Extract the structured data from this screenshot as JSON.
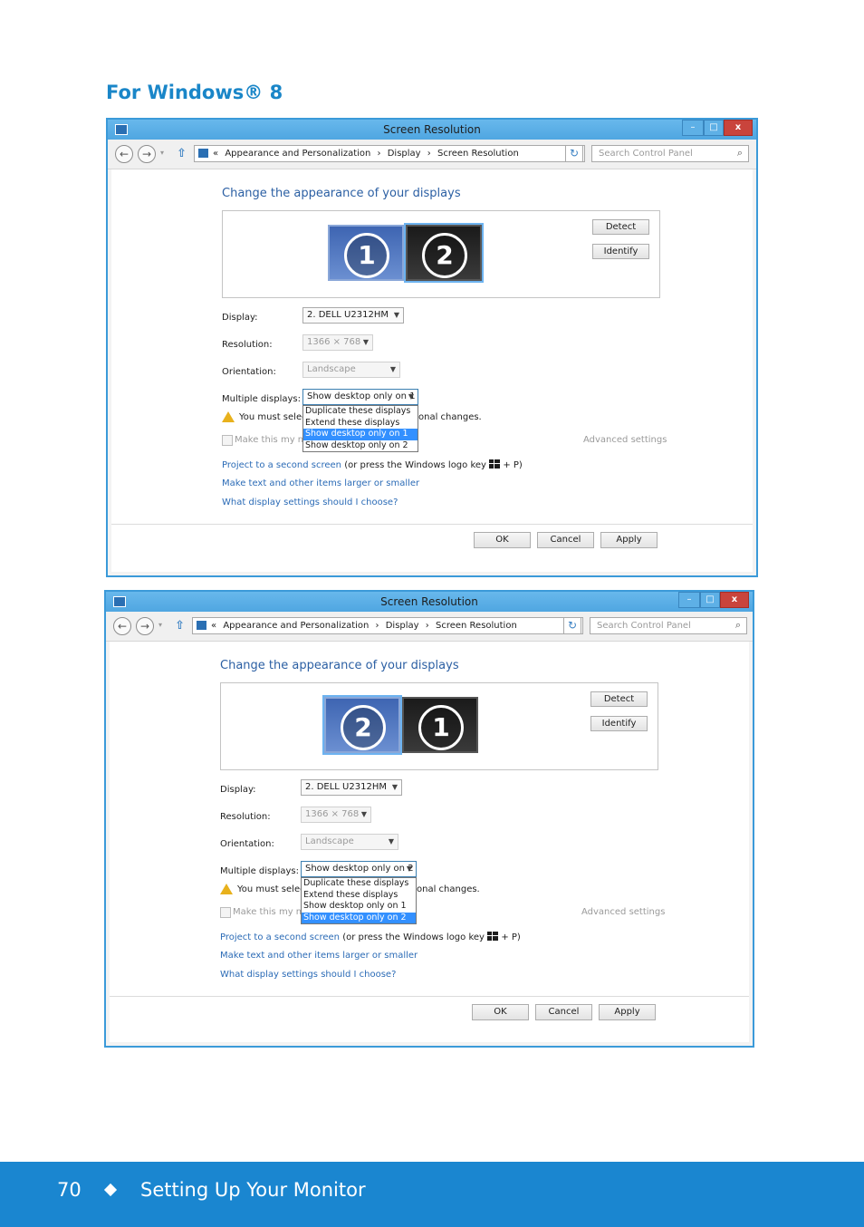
{
  "heading": "For Windows® 8",
  "windows": [
    {
      "title": "Screen Resolution",
      "nav": {
        "back": "←",
        "forward": "→",
        "up": "⇧",
        "crumb_prefix": "«",
        "crumbs": [
          "Appearance and Personalization",
          "Display",
          "Screen Resolution"
        ],
        "sep": "›",
        "refresh": "↻",
        "search_placeholder": "Search Control Panel",
        "search_icon": "⌕"
      },
      "controls": {
        "minimize": "–",
        "maximize": "□",
        "close": "x"
      },
      "change_title": "Change the appearance of your displays",
      "monitors": [
        "1",
        "2"
      ],
      "detect": "Detect",
      "identify": "Identify",
      "display_label": "Display:",
      "display_value": "2. DELL U2312HM",
      "resolution_label": "Resolution:",
      "resolution_value": "1366 × 768",
      "orientation_label": "Orientation:",
      "orientation_value": "Landscape",
      "multiple_label": "Multiple displays:",
      "multiple_value": "Show desktop only on 1",
      "dropdown_options": [
        "Duplicate these displays",
        "Extend these displays",
        "Show desktop only on 1",
        "Show desktop only on 2"
      ],
      "warning_text": "You must select",
      "warning_tail": "onal changes.",
      "checkbox_label": "Make this my ma",
      "advanced": "Advanced settings",
      "link1": "Project to a second screen",
      "link1_suffix_a": "(or press the Windows logo key",
      "link1_suffix_b": "+ P)",
      "link2": "Make text and other items larger or smaller",
      "link3": "What display settings should I choose?",
      "ok": "OK",
      "cancel": "Cancel",
      "apply": "Apply"
    },
    {
      "title": "Screen Resolution",
      "nav": {
        "back": "←",
        "forward": "→",
        "up": "⇧",
        "crumb_prefix": "«",
        "crumbs": [
          "Appearance and Personalization",
          "Display",
          "Screen Resolution"
        ],
        "sep": "›",
        "refresh": "↻",
        "search_placeholder": "Search Control Panel",
        "search_icon": "⌕"
      },
      "controls": {
        "minimize": "–",
        "maximize": "□",
        "close": "x"
      },
      "change_title": "Change the appearance of your displays",
      "monitors": [
        "2",
        "1"
      ],
      "detect": "Detect",
      "identify": "Identify",
      "display_label": "Display:",
      "display_value": "2. DELL U2312HM",
      "resolution_label": "Resolution:",
      "resolution_value": "1366 × 768",
      "orientation_label": "Orientation:",
      "orientation_value": "Landscape",
      "multiple_label": "Multiple displays:",
      "multiple_value": "Show desktop only on 2",
      "dropdown_options": [
        "Duplicate these displays",
        "Extend these displays",
        "Show desktop only on 1",
        "Show desktop only on 2"
      ],
      "warning_text": "You must select",
      "warning_tail": "onal changes.",
      "checkbox_label": "Make this my ma",
      "advanced": "Advanced settings",
      "link1": "Project to a second screen",
      "link1_suffix_a": "(or press the Windows logo key",
      "link1_suffix_b": "+ P)",
      "link2": "Make text and other items larger or smaller",
      "link3": "What display settings should I choose?",
      "ok": "OK",
      "cancel": "Cancel",
      "apply": "Apply"
    }
  ],
  "footer": {
    "page_number": "70",
    "bullet": "◆",
    "section": "Setting Up Your Monitor"
  },
  "colors": {
    "accent": "#1a86c8",
    "footer_bg": "#1a86d0",
    "highlight": "#3390ff"
  }
}
